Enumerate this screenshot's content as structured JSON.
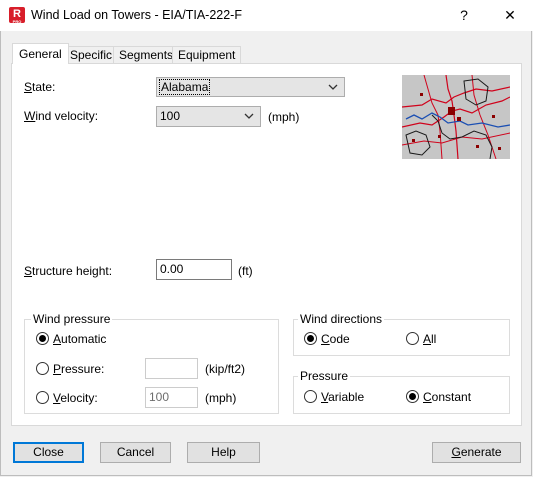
{
  "window": {
    "title": "Wind Load on Towers - EIA/TIA-222-F",
    "app_icon_letter": "R",
    "app_icon_sub": "PRO",
    "help_glyph": "?",
    "close_glyph": "✕"
  },
  "tabs": [
    {
      "label": "General",
      "active": true
    },
    {
      "label": "Specific",
      "active": false
    },
    {
      "label": "Segments",
      "active": false
    },
    {
      "label": "Equipment",
      "active": false
    }
  ],
  "general": {
    "state": {
      "label_u": "S",
      "label_rest": "tate:",
      "value": "Alabama"
    },
    "wind_velocity": {
      "label_u": "W",
      "label_rest": "ind velocity:",
      "value": "100",
      "unit": "(mph)"
    },
    "structure_height": {
      "label_u": "S",
      "label_rest": "tructure height:",
      "value": "0.00",
      "unit": "(ft)"
    }
  },
  "wind_pressure": {
    "title": "Wind pressure",
    "automatic": {
      "label_u": "A",
      "label_rest": "utomatic",
      "selected": true
    },
    "pressure": {
      "label_u": "P",
      "label_rest": "ressure:",
      "selected": false,
      "value": "",
      "unit": "(kip/ft2)"
    },
    "velocity": {
      "label_u": "V",
      "label_rest": "elocity:",
      "selected": false,
      "value": "100",
      "unit": "(mph)"
    }
  },
  "wind_directions": {
    "title": "Wind directions",
    "code": {
      "label_u": "C",
      "label_rest": "ode",
      "selected": true
    },
    "all": {
      "label_u": "A",
      "label_rest": "ll",
      "selected": false
    }
  },
  "pressure_mode": {
    "title": "Pressure",
    "variable": {
      "label_u": "V",
      "label_rest": "ariable",
      "selected": false
    },
    "constant": {
      "label_u": "C",
      "label_rest": "onstant",
      "selected": true
    }
  },
  "buttons": {
    "close": "Close",
    "cancel": "Cancel",
    "help": "Help",
    "generate_u": "G",
    "generate_rest": "enerate"
  },
  "colors": {
    "accent": "#0078d7",
    "map_road": "#d0021b",
    "map_bg": "#c6c6c6"
  }
}
